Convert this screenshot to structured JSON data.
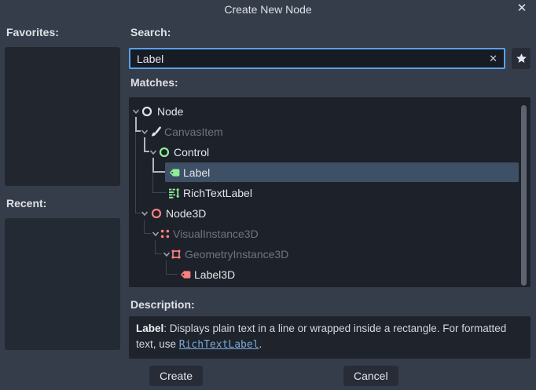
{
  "window": {
    "title": "Create New Node"
  },
  "left_panel": {
    "favorites_label": "Favorites:",
    "recent_label": "Recent:"
  },
  "search": {
    "label": "Search:",
    "value": "Label"
  },
  "matches_label": "Matches:",
  "tree": {
    "items": [
      {
        "name": "Node"
      },
      {
        "name": "CanvasItem"
      },
      {
        "name": "Control"
      },
      {
        "name": "Label",
        "selected": true
      },
      {
        "name": "RichTextLabel"
      },
      {
        "name": "Node3D"
      },
      {
        "name": "VisualInstance3D"
      },
      {
        "name": "GeometryInstance3D"
      },
      {
        "name": "Label3D"
      }
    ]
  },
  "description": {
    "label": "Description:",
    "term": "Label",
    "body": ": Displays plain text in a line or wrapped inside a rectangle. For formatted text, use ",
    "link": "RichTextLabel",
    "suffix": "."
  },
  "buttons": {
    "create": "Create",
    "cancel": "Cancel"
  },
  "icons": {
    "close": "✕",
    "clear": "✕"
  },
  "colors": {
    "accent_blue": "#5aa1e8",
    "control_green": "#8eef97",
    "node3d_red": "#fc7f7f",
    "selection": "#3e5065",
    "dialog_bg": "#363d4a",
    "panel_bg": "#1d2129"
  }
}
